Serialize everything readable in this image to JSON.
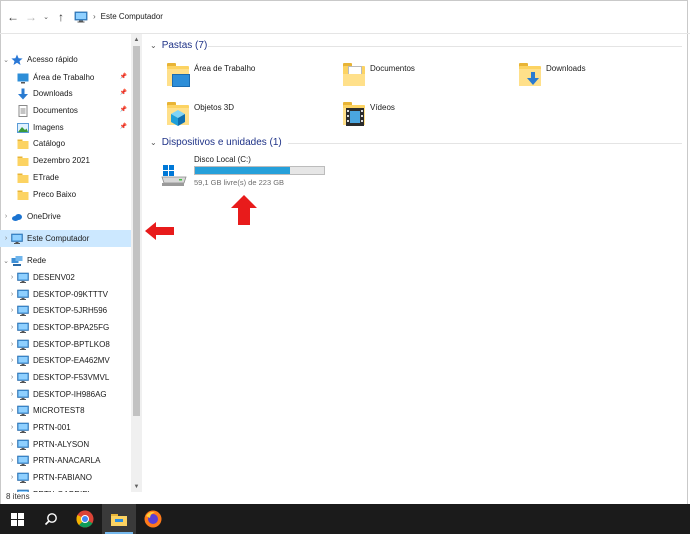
{
  "addressbar": {
    "back_glyph": "←",
    "forward_glyph": "→",
    "dropdown_glyph": "⌄",
    "up_glyph": "↑",
    "path": [
      "Este Computador"
    ]
  },
  "navpane": {
    "items": [
      {
        "label": "Acesso rápido",
        "icon": "star-icon",
        "expander": "expanded",
        "indent": 0
      },
      {
        "label": "Área de Trabalho",
        "icon": "desktop-folder-icon",
        "pinned": true,
        "indent": 1
      },
      {
        "label": "Downloads",
        "icon": "download-icon",
        "pinned": true,
        "indent": 1
      },
      {
        "label": "Documentos",
        "icon": "documents-icon",
        "pinned": true,
        "indent": 1
      },
      {
        "label": "Imagens",
        "icon": "pictures-icon",
        "pinned": true,
        "indent": 1
      },
      {
        "label": "Catálogo",
        "icon": "folder-icon",
        "indent": 1
      },
      {
        "label": "Dezembro 2021",
        "icon": "folder-icon",
        "indent": 1
      },
      {
        "label": "ETrade",
        "icon": "folder-icon",
        "indent": 1
      },
      {
        "label": "Preco Baixo",
        "icon": "folder-icon",
        "indent": 1
      },
      {
        "label": "OneDrive",
        "icon": "cloud-icon",
        "expander": "collapsed",
        "indent": 0
      },
      {
        "label": "Este Computador",
        "icon": "computer-icon",
        "expander": "collapsed",
        "indent": 0,
        "selected": true
      },
      {
        "label": "Rede",
        "icon": "network-icon",
        "expander": "expanded",
        "indent": 0
      },
      {
        "label": "DESENV02",
        "icon": "computer-icon",
        "expander": "collapsed",
        "indent": 1
      },
      {
        "label": "DESKTOP-09KTTTV",
        "icon": "computer-icon",
        "expander": "collapsed",
        "indent": 1
      },
      {
        "label": "DESKTOP-5JRH596",
        "icon": "computer-icon",
        "expander": "collapsed",
        "indent": 1
      },
      {
        "label": "DESKTOP-BPA25FG",
        "icon": "computer-icon",
        "expander": "collapsed",
        "indent": 1
      },
      {
        "label": "DESKTOP-BPTLKO8",
        "icon": "computer-icon",
        "expander": "collapsed",
        "indent": 1
      },
      {
        "label": "DESKTOP-EA462MV",
        "icon": "computer-icon",
        "expander": "collapsed",
        "indent": 1
      },
      {
        "label": "DESKTOP-F53VMVL",
        "icon": "computer-icon",
        "expander": "collapsed",
        "indent": 1
      },
      {
        "label": "DESKTOP-IH986AG",
        "icon": "computer-icon",
        "expander": "collapsed",
        "indent": 1
      },
      {
        "label": "MICROTEST8",
        "icon": "computer-icon",
        "expander": "collapsed",
        "indent": 1
      },
      {
        "label": "PRTN-001",
        "icon": "computer-icon",
        "expander": "collapsed",
        "indent": 1
      },
      {
        "label": "PRTN-ALYSON",
        "icon": "computer-icon",
        "expander": "collapsed",
        "indent": 1
      },
      {
        "label": "PRTN-ANACARLA",
        "icon": "computer-icon",
        "expander": "collapsed",
        "indent": 1
      },
      {
        "label": "PRTN-FABIANO",
        "icon": "computer-icon",
        "expander": "collapsed",
        "indent": 1
      },
      {
        "label": "PRTN-GABRIEL",
        "icon": "computer-icon",
        "expander": "collapsed",
        "indent": 1
      }
    ]
  },
  "status": {
    "item_count": "8 itens"
  },
  "content": {
    "folders_header": "Pastas (7)",
    "folders": [
      {
        "label": "Área de Trabalho",
        "overlay": "desktop-icon"
      },
      {
        "label": "Documentos",
        "overlay": "document-icon"
      },
      {
        "label": "Downloads",
        "overlay": "download-icon"
      },
      {
        "label": "Objetos 3D",
        "overlay": "cube-icon"
      },
      {
        "label": "Vídeos",
        "overlay": "film-icon"
      }
    ],
    "devices_header": "Dispositivos e unidades (1)",
    "drive": {
      "name": "Disco Local (C:)",
      "free_text": "59,1 GB livre(s) de 223 GB",
      "used_fraction": 0.735,
      "bar_color": "#26a0da"
    }
  },
  "taskbar": {
    "items": [
      "start-icon",
      "search-icon",
      "chrome-icon",
      "file-explorer-icon",
      "firefox-icon"
    ],
    "active": "file-explorer-icon"
  },
  "colors": {
    "selection": "#cce8ff",
    "header_text": "#1e3287",
    "annotation_arrow": "#e81b1b",
    "taskbar": "#1b1b1b"
  }
}
